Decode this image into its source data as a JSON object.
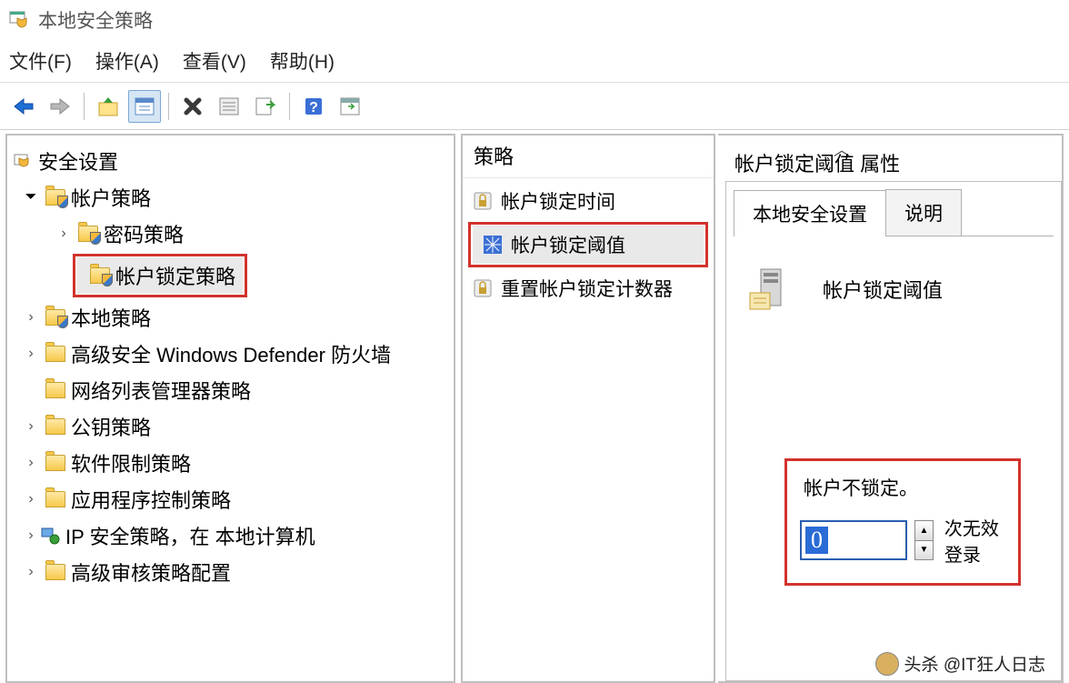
{
  "window": {
    "title": "本地安全策略"
  },
  "menu": {
    "file": "文件(F)",
    "action": "操作(A)",
    "view": "查看(V)",
    "help": "帮助(H)"
  },
  "tree": {
    "root": "安全设置",
    "account_policy": "帐户策略",
    "password_policy": "密码策略",
    "lockout_policy": "帐户锁定策略",
    "local_policy": "本地策略",
    "defender": "高级安全 Windows Defender 防火墙",
    "network_list": "网络列表管理器策略",
    "public_key": "公钥策略",
    "software_restrict": "软件限制策略",
    "app_control": "应用程序控制策略",
    "ip_security": "IP 安全策略，在 本地计算机",
    "audit": "高级审核策略配置"
  },
  "middle": {
    "header": "策略",
    "items": {
      "lockout_duration": "帐户锁定时间",
      "lockout_threshold": "帐户锁定阈值",
      "reset_counter": "重置帐户锁定计数器"
    }
  },
  "props": {
    "title": "帐户锁定阈值 属性",
    "tab_local": "本地安全设置",
    "tab_desc": "说明",
    "field_label": "帐户锁定阈值",
    "lock_text": "帐户不锁定。",
    "value": "0",
    "suffix": "次无效登录"
  },
  "watermark": "头杀 @IT狂人日志"
}
